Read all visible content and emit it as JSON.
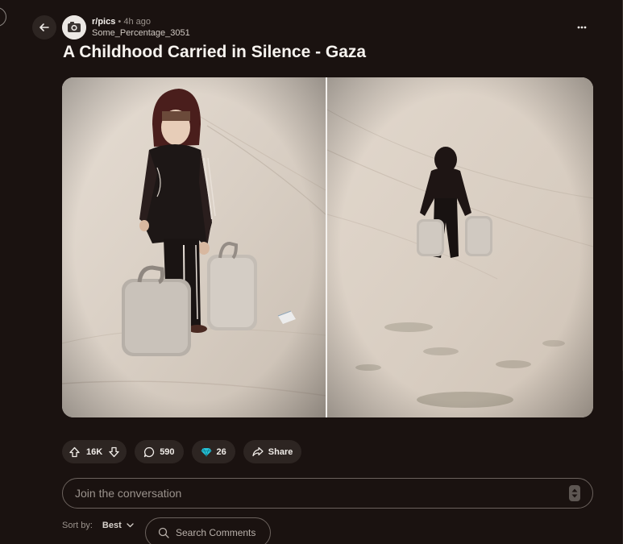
{
  "post": {
    "subreddit": "r/pics",
    "separator": "•",
    "time_ago": "4h ago",
    "author": "Some_Percentage_3051",
    "title": "A Childhood Carried in Silence - Gaza"
  },
  "icons": {
    "back": "arrow-left-icon",
    "more": "more-horizontal-icon",
    "upvote": "arrow-up-icon",
    "downvote": "arrow-down-icon",
    "comments": "speech-bubble-icon",
    "award": "diamond-icon",
    "share": "share-arrow-icon",
    "search": "search-icon",
    "chevron": "chevron-down-icon"
  },
  "actions": {
    "votes": "16K",
    "comments": "590",
    "awards": "26",
    "share_label": "Share"
  },
  "comment_box": {
    "placeholder": "Join the conversation"
  },
  "sort": {
    "label": "Sort by:",
    "value": "Best"
  },
  "search": {
    "label": "Search Comments"
  },
  "colors": {
    "background": "#1a1210",
    "pill": "#2d2522",
    "award": "#27c2d6"
  }
}
